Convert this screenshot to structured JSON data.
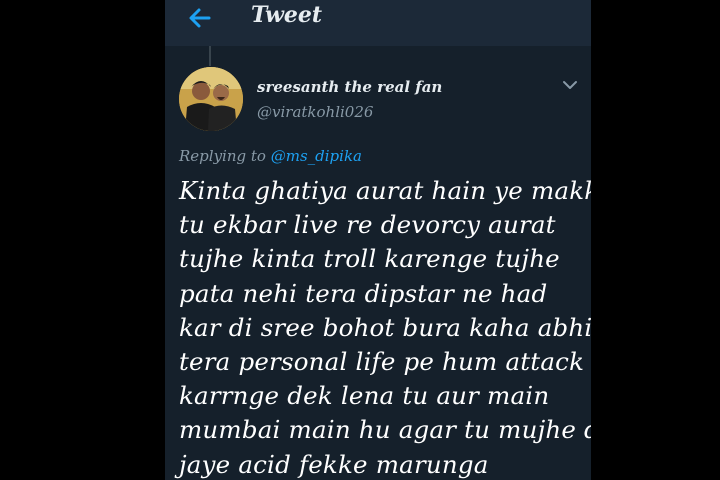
{
  "header": {
    "title": "Tweet",
    "back_icon": "arrow-left-icon"
  },
  "tweet": {
    "display_name": "sreesanth the real fan",
    "handle": "@viratkohli026",
    "replying_prefix": "Replying to",
    "replying_to": "@ms_dipika",
    "text_lines": [
      "Kinta ghatiya aurat hain ye makki",
      "tu ekbar live re devorcy aurat",
      "tujhe kinta troll karenge tujhe",
      "pata nehi tera dipstar ne had",
      "kar di sree bohot bura kaha abhi",
      "tera personal life pe hum attack",
      "karrnge dek lena tu aur main",
      "mumbai main hu agar tu mujhe dik",
      "jaye acid fekke marunga"
    ]
  },
  "colors": {
    "background": "#15202b",
    "header": "#1c2938",
    "accent": "#1da1f2",
    "secondary_text": "#8899a6"
  }
}
